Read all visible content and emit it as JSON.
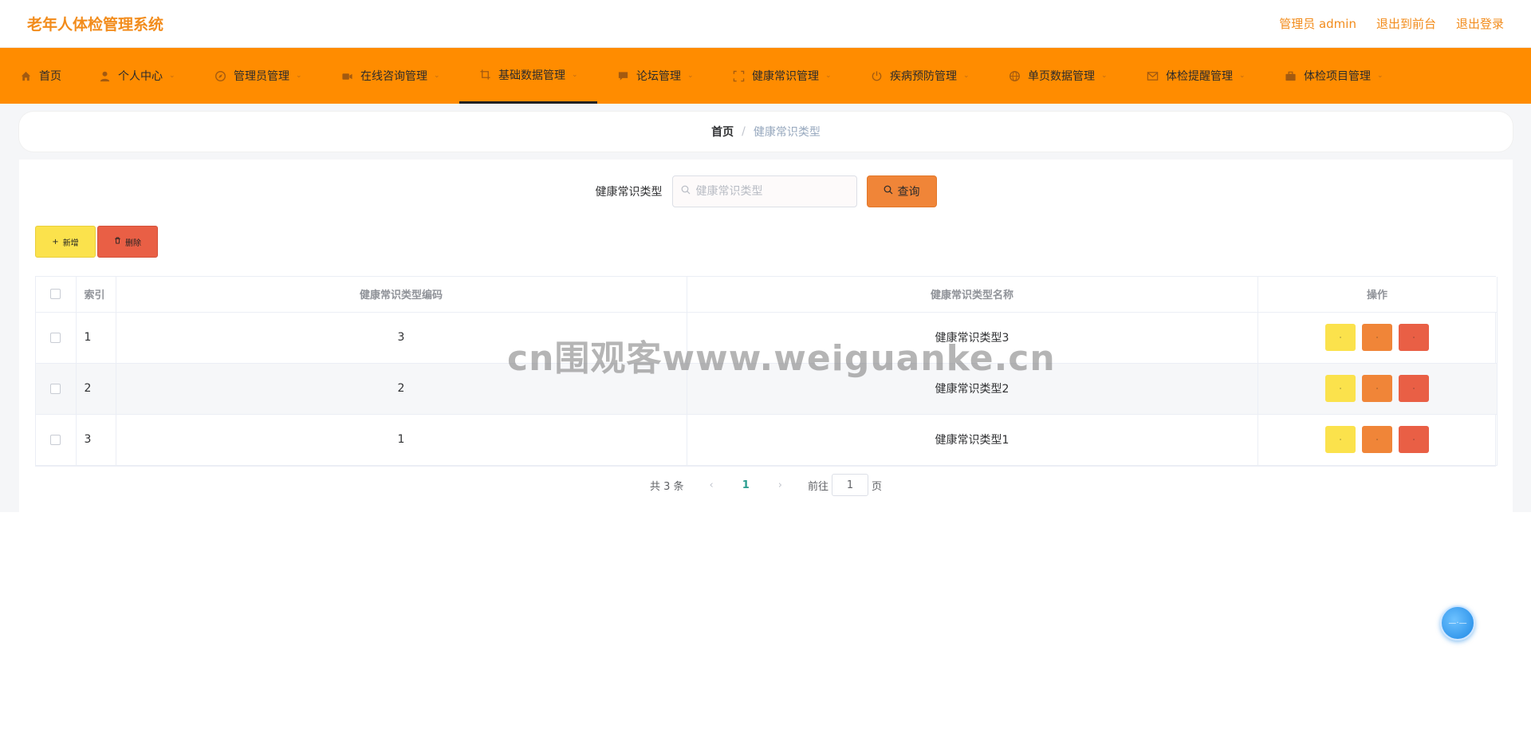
{
  "header": {
    "title": "老年人体检管理系统",
    "links": [
      "管理员 admin",
      "退出到前台",
      "退出登录"
    ]
  },
  "nav": {
    "items": [
      {
        "label": "首页",
        "icon": "home-icon"
      },
      {
        "label": "个人中心",
        "icon": "user-icon"
      },
      {
        "label": "管理员管理",
        "icon": "compass-icon"
      },
      {
        "label": "在线咨询管理",
        "icon": "video-icon"
      },
      {
        "label": "基础数据管理",
        "icon": "crop-icon",
        "active": true
      },
      {
        "label": "论坛管理",
        "icon": "chat-icon"
      },
      {
        "label": "健康常识管理",
        "icon": "fullscreen-icon"
      },
      {
        "label": "疾病预防管理",
        "icon": "power-icon"
      },
      {
        "label": "单页数据管理",
        "icon": "globe-icon"
      },
      {
        "label": "体检提醒管理",
        "icon": "mail-icon"
      },
      {
        "label": "体检项目管理",
        "icon": "briefcase-icon"
      }
    ]
  },
  "breadcrumb": {
    "home": "首页",
    "separator": "/",
    "current": "健康常识类型"
  },
  "search": {
    "label": "健康常识类型",
    "placeholder": "健康常识类型",
    "button": "查询"
  },
  "actions": {
    "add": "新增",
    "delete": "删除"
  },
  "table": {
    "columns": [
      "索引",
      "健康常识类型编码",
      "健康常识类型名称",
      "操作"
    ],
    "rows": [
      {
        "index": "1",
        "code": "3",
        "name": "健康常识类型3"
      },
      {
        "index": "2",
        "code": "2",
        "name": "健康常识类型2"
      },
      {
        "index": "3",
        "code": "1",
        "name": "健康常识类型1"
      }
    ],
    "op_labels": {
      "view": "·",
      "edit": "·",
      "delete": "·"
    }
  },
  "pagination": {
    "total": "共 3 条",
    "current": "1",
    "goto_label": "前往",
    "goto_value": "1",
    "page_suffix": "页"
  },
  "watermark": "cn围观客www.weiguanke.cn",
  "colors": {
    "brand": "#ff8c00",
    "title": "#f28c1c",
    "yellow": "#fbe24c",
    "orange": "#f08538",
    "red": "#e95f45"
  }
}
